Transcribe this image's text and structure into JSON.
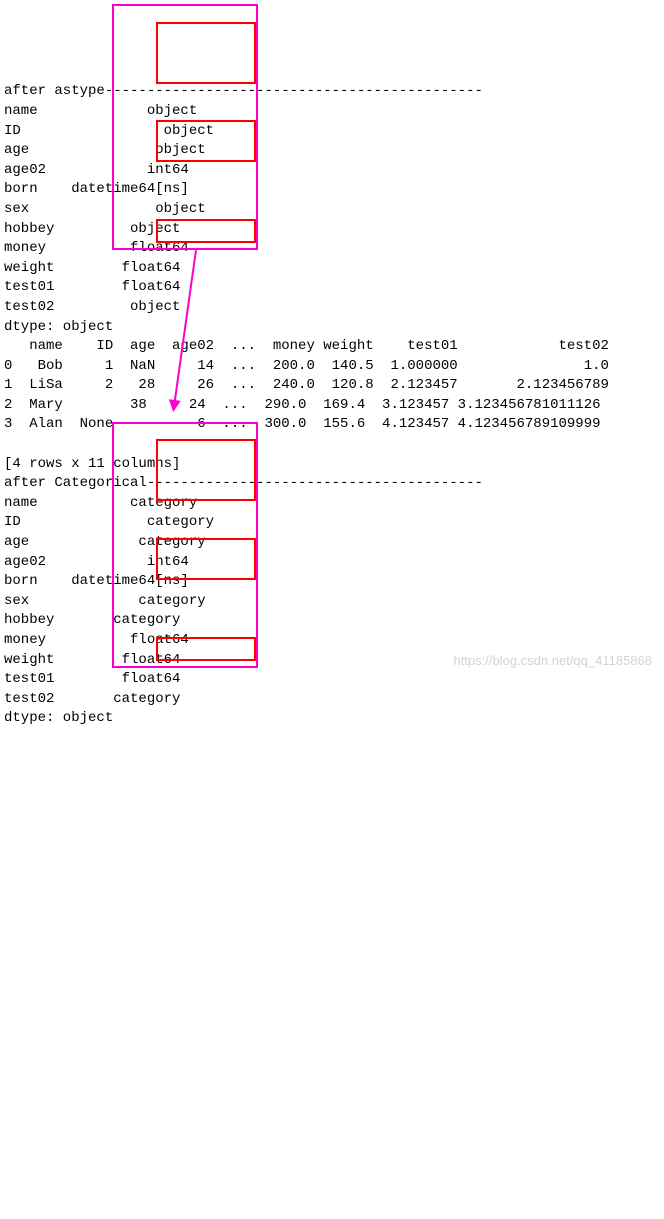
{
  "section1": {
    "header": "after astype---------------------------------------------",
    "dtypes": [
      [
        "name",
        "         object"
      ],
      [
        "ID",
        "           object"
      ],
      [
        "age",
        "          object"
      ],
      [
        "age02",
        "         int64"
      ],
      [
        "born",
        "datetime64[ns]"
      ],
      [
        "sex",
        "          object"
      ],
      [
        "hobbey",
        "       object"
      ],
      [
        "money",
        "       float64"
      ],
      [
        "weight",
        "      float64"
      ],
      [
        "test01",
        "      float64"
      ],
      [
        "test02",
        "       object"
      ]
    ],
    "dtype_line": "dtype: object"
  },
  "dataframe": {
    "header": "   name    ID  age  age02  ...  money weight    test01            test02",
    "rows": [
      "0   Bob     1  NaN     14  ...  200.0  140.5  1.000000               1.0",
      "1  LiSa     2   28     26  ...  240.0  120.8  2.123457       2.123456789",
      "2  Mary        38     24  ...  290.0  169.4  3.123457 3.123456781011126",
      "3  Alan  None          6  ...  300.0  155.6  4.123457 4.123456789109999"
    ],
    "shape_line": "[4 rows x 11 columns]"
  },
  "section2": {
    "header": "after Categorical----------------------------------------",
    "dtypes": [
      [
        "name",
        "       category"
      ],
      [
        "ID",
        "         category"
      ],
      [
        "age",
        "        category"
      ],
      [
        "age02",
        "         int64"
      ],
      [
        "born",
        "datetime64[ns]"
      ],
      [
        "sex",
        "        category"
      ],
      [
        "hobbey",
        "     category"
      ],
      [
        "money",
        "       float64"
      ],
      [
        "weight",
        "      float64"
      ],
      [
        "test01",
        "      float64"
      ],
      [
        "test02",
        "     category"
      ]
    ],
    "dtype_line": "dtype: object"
  },
  "watermark": "https://blog.csdn.net/qq_41185868"
}
